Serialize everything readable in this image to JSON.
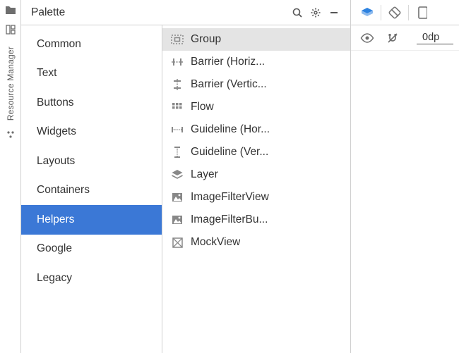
{
  "leftRail": {
    "label": "Resource Manager"
  },
  "palette": {
    "title": "Palette",
    "categories": [
      {
        "label": "Common",
        "selected": false
      },
      {
        "label": "Text",
        "selected": false
      },
      {
        "label": "Buttons",
        "selected": false
      },
      {
        "label": "Widgets",
        "selected": false
      },
      {
        "label": "Layouts",
        "selected": false
      },
      {
        "label": "Containers",
        "selected": false
      },
      {
        "label": "Helpers",
        "selected": true
      },
      {
        "label": "Google",
        "selected": false
      },
      {
        "label": "Legacy",
        "selected": false
      }
    ],
    "components": [
      {
        "icon": "group",
        "label": "Group",
        "selected": true
      },
      {
        "icon": "barrier-h",
        "label": "Barrier (Horiz...",
        "selected": false
      },
      {
        "icon": "barrier-v",
        "label": "Barrier (Vertic...",
        "selected": false
      },
      {
        "icon": "flow",
        "label": "Flow",
        "selected": false
      },
      {
        "icon": "guideline-h",
        "label": "Guideline (Hor...",
        "selected": false
      },
      {
        "icon": "guideline-v",
        "label": "Guideline (Ver...",
        "selected": false
      },
      {
        "icon": "layer",
        "label": "Layer",
        "selected": false
      },
      {
        "icon": "image",
        "label": "ImageFilterView",
        "selected": false
      },
      {
        "icon": "image",
        "label": "ImageFilterBu...",
        "selected": false
      },
      {
        "icon": "mock",
        "label": "MockView",
        "selected": false
      }
    ]
  },
  "rightPanel": {
    "marginValue": "0dp"
  }
}
